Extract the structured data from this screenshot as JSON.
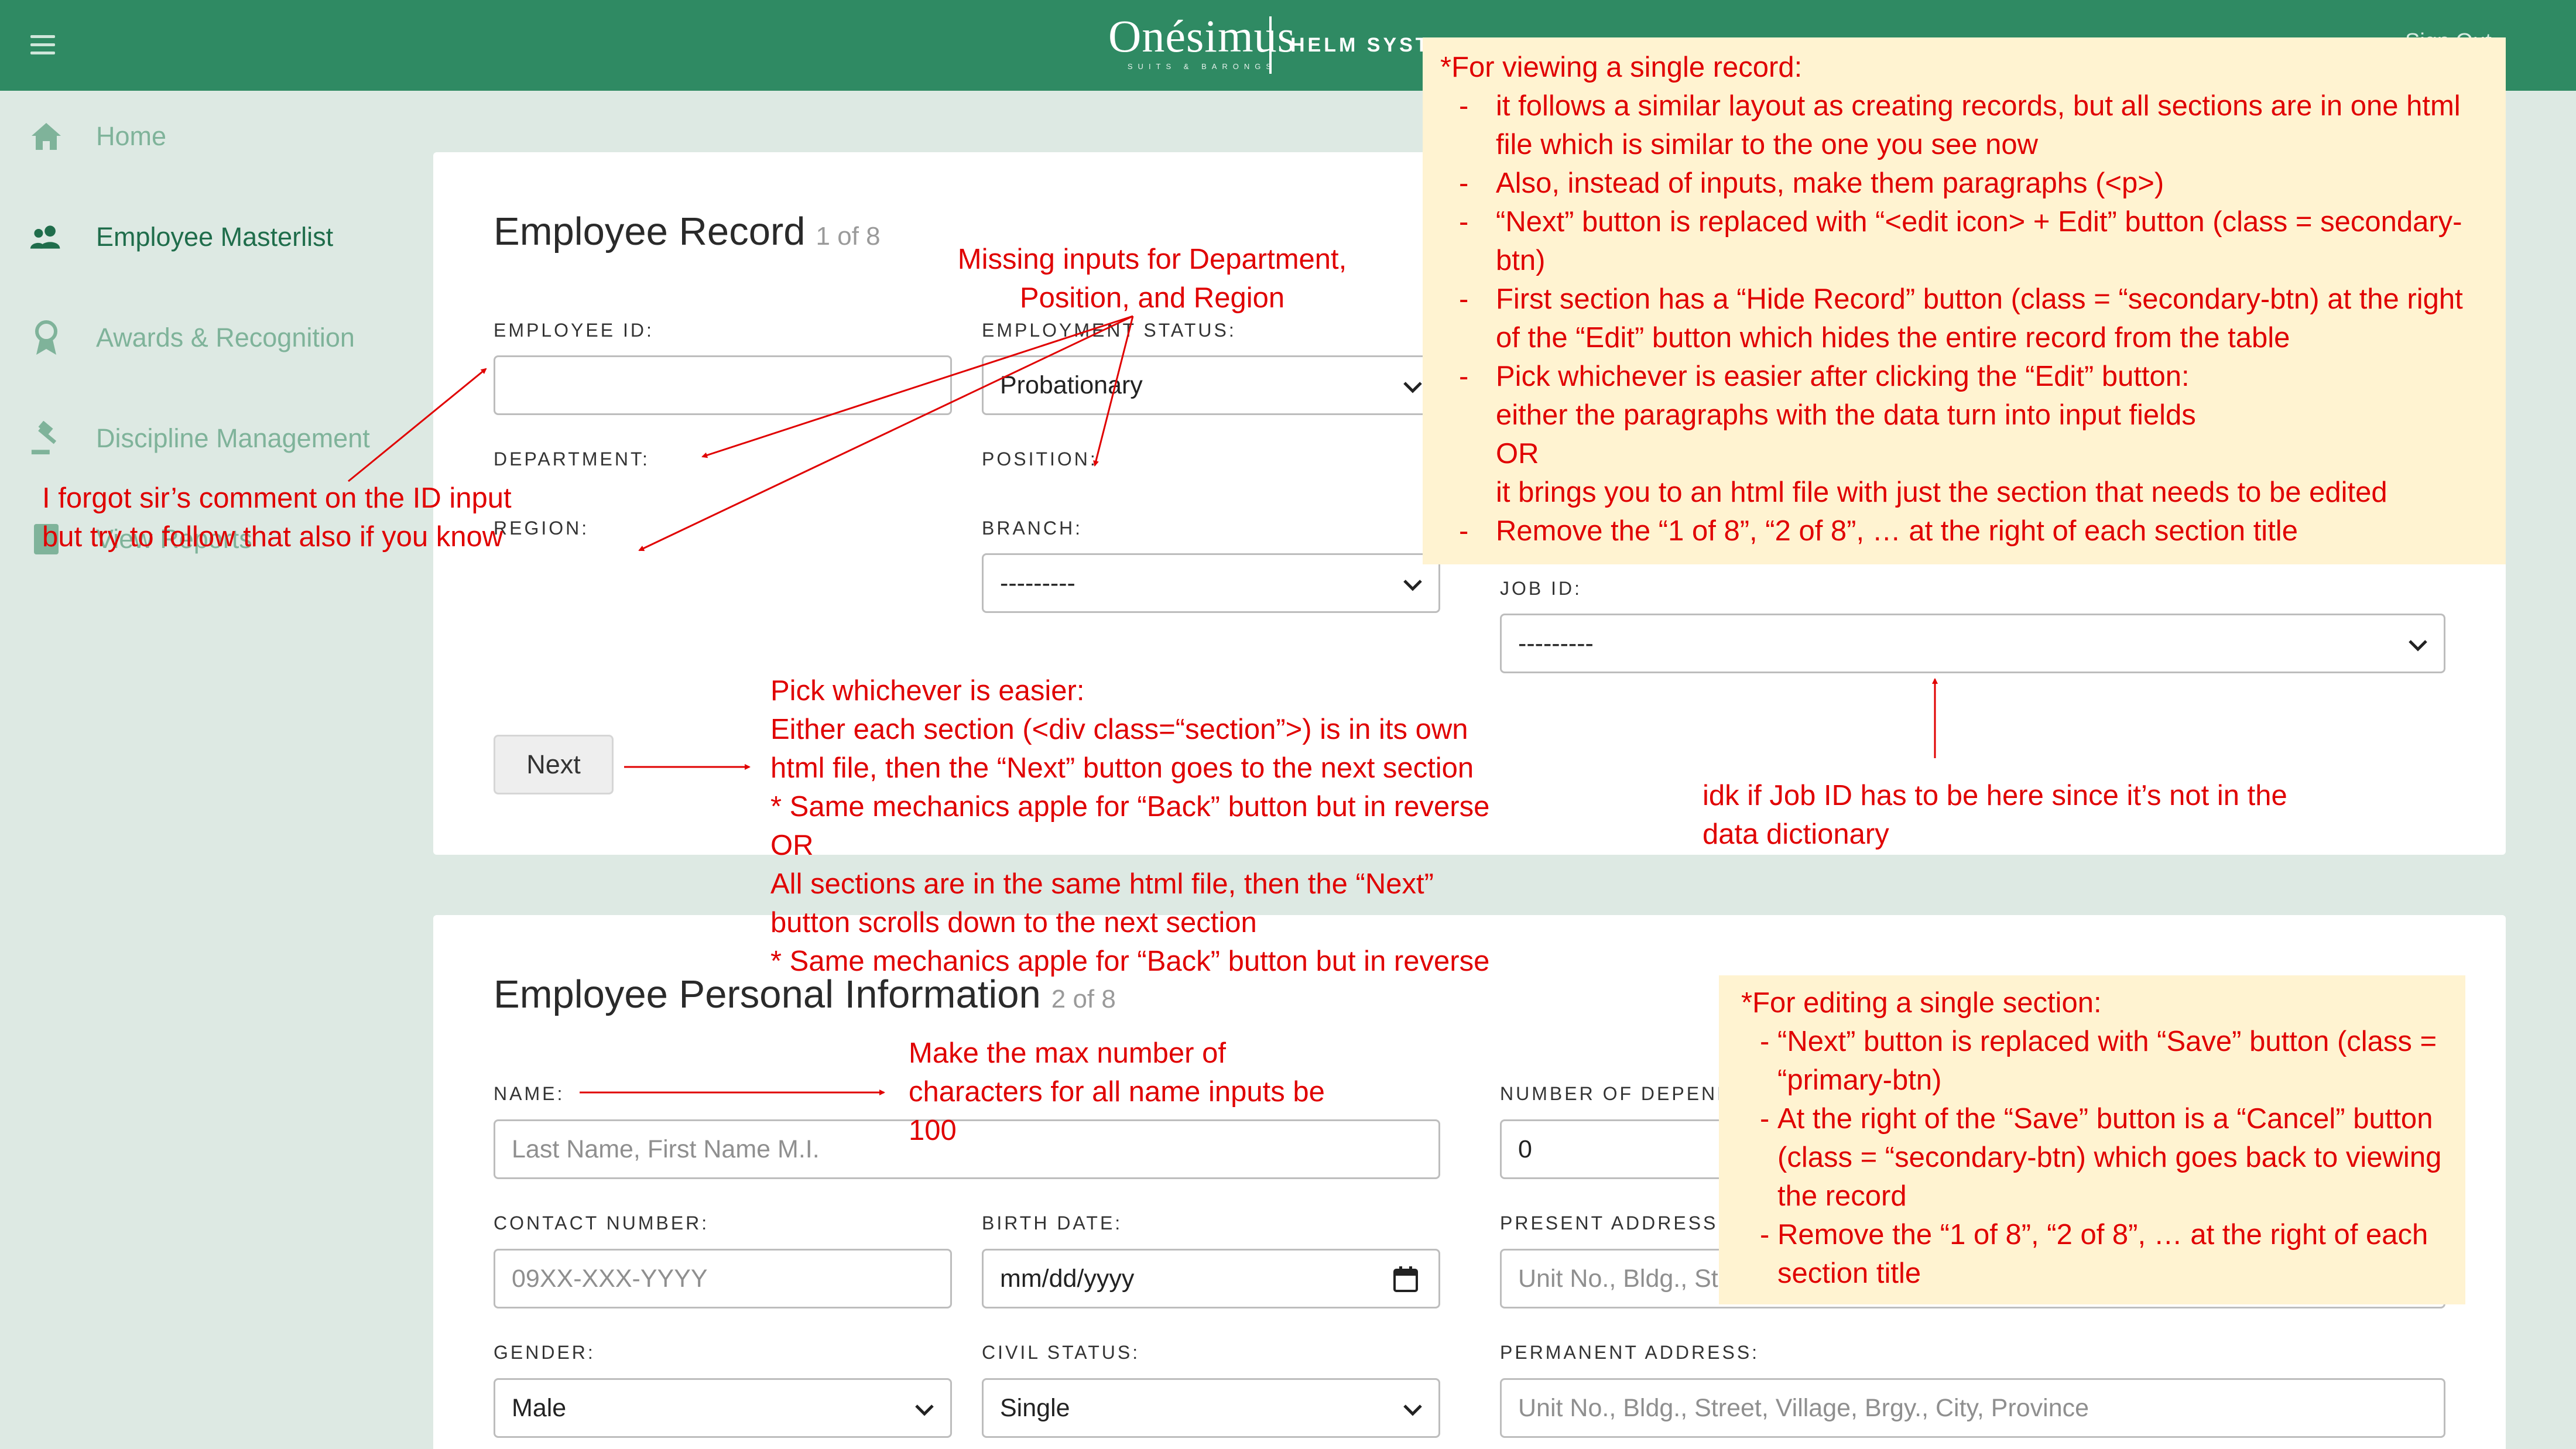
{
  "topbar": {
    "logo_text": "Onésimus",
    "logo_subtext": "SUITS & BARONGS",
    "system_name": "HELM SYSTEM",
    "signout": "Sign Out"
  },
  "sidebar": {
    "items": [
      {
        "label": "Home",
        "icon": "home-icon"
      },
      {
        "label": "Employee Masterlist",
        "icon": "people-icon"
      },
      {
        "label": "Awards & Recognition",
        "icon": "award-icon"
      },
      {
        "label": "Discipline Management",
        "icon": "gavel-icon"
      },
      {
        "label": "View Reports",
        "icon": "report-icon"
      }
    ]
  },
  "record": {
    "title": "Employee Record",
    "counter": "1 of 8",
    "employee_id_label": "EMPLOYEE ID:",
    "employee_id_value": "",
    "employment_status_label": "EMPLOYMENT STATUS:",
    "employment_status_value": "Probationary",
    "department_label": "DEPARTMENT:",
    "position_label": "POSITION:",
    "region_label": "REGION:",
    "branch_label": "BRANCH:",
    "branch_value": "---------",
    "job_id_label": "JOB ID:",
    "job_id_value": "---------",
    "next_label": "Next"
  },
  "personal": {
    "title": "Employee Personal Information",
    "counter": "2 of 8",
    "name_label": "NAME:",
    "name_placeholder": "Last Name, First Name M.I.",
    "dependents_label": "NUMBER OF DEPENDENTS:",
    "dependents_value": "0",
    "contact_label": "CONTACT NUMBER:",
    "contact_placeholder": "09XX-XXX-YYYY",
    "birth_label": "BIRTH DATE:",
    "birth_placeholder": "mm/dd/yyyy",
    "present_address_label": "PRESENT ADDRESS:",
    "present_address_placeholder": "Unit No., Bldg., Street, Village, Brgy., City, Province",
    "gender_label": "GENDER:",
    "gender_value": "Male",
    "civil_label": "CIVIL STATUS:",
    "civil_value": "Single",
    "permanent_address_label": "PERMANENT ADDRESS:",
    "permanent_address_placeholder": "Unit No., Bldg., Street, Village, Brgy., City, Province"
  },
  "annotations": {
    "missing_inputs": [
      "Missing inputs for Department,",
      "Position, and Region"
    ],
    "forgot_comment": [
      "I forgot sir’s comment on the ID input",
      "but try to follow that also if you know"
    ],
    "pick_whichever": [
      "Pick whichever is easier:",
      "Either each section (<div class=“section”>) is in its own",
      "html file, then the “Next” button goes to the next section",
      "* Same mechanics apple for “Back” button but in reverse",
      "OR",
      "All sections are in the same html file, then the “Next”",
      "button scrolls down to the next section",
      "* Same mechanics apple for “Back” button but in reverse"
    ],
    "job_id_note": [
      "idk if Job ID has to be here since it’s not in the",
      "data dictionary"
    ],
    "max_chars": [
      "Make the max number of",
      "characters for all name inputs be",
      "100"
    ],
    "viewing": {
      "heading": "*For viewing a single record:",
      "item1": "it follows a similar layout as creating records, but all sections are in one html file which is similar to the one you see now",
      "item2": "Also, instead of inputs, make them paragraphs (<p>)",
      "item3": "“Next” button is replaced with “<edit icon> + Edit” button (class = secondary-btn)",
      "item4": "First section has a “Hide Record” button (class = “secondary-btn) at the right of the “Edit” button which hides the entire record from the table",
      "item5": "Pick whichever is easier after clicking the “Edit” button:",
      "item5b": "either the paragraphs with the data turn into input fields",
      "item5c": "OR",
      "item5d": "it brings you to an html file with just the section that needs to be edited",
      "item6": "Remove the “1 of 8”, “2 of 8”, … at the right of each section title"
    },
    "editing": {
      "heading": "*For editing a single section:",
      "item1": "“Next” button is replaced with “Save” button (class = “primary-btn)",
      "item2": "At the right of the “Save” button is a “Cancel” button (class = “secondary-btn) which goes back to viewing the record",
      "item3": "Remove the “1 of 8”, “2 of 8”, … at the right of each section title"
    }
  },
  "colors": {
    "topbar": "#2f8a63",
    "sidebar_bg": "#dde9e3",
    "annotation_red": "#e00000",
    "note_bg": "#fff3d1"
  }
}
